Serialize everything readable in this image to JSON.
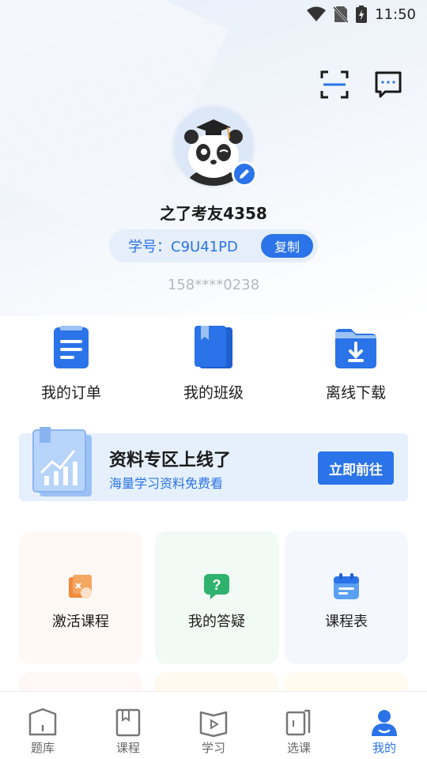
{
  "status_bar": {
    "time": "11:50"
  },
  "profile": {
    "username": "之了考友4358",
    "student_id_label": "学号：C9U41PD",
    "copy_label": "复制",
    "phone": "158****0238"
  },
  "quick_actions": [
    {
      "label": "我的订单",
      "icon": "order-icon"
    },
    {
      "label": "我的班级",
      "icon": "class-book-icon"
    },
    {
      "label": "离线下载",
      "icon": "download-folder-icon"
    }
  ],
  "banner": {
    "title": "资料专区上线了",
    "subtitle": "海量学习资料免费看",
    "button": "立即前往"
  },
  "cards": [
    {
      "label": "激活课程",
      "icon": "activate-icon"
    },
    {
      "label": "我的答疑",
      "icon": "question-icon"
    },
    {
      "label": "课程表",
      "icon": "calendar-icon"
    }
  ],
  "tabs": [
    {
      "label": "题库",
      "icon": "question-bank-icon"
    },
    {
      "label": "课程",
      "icon": "course-icon"
    },
    {
      "label": "学习",
      "icon": "study-icon"
    },
    {
      "label": "选课",
      "icon": "select-course-icon"
    },
    {
      "label": "我的",
      "icon": "profile-icon"
    }
  ],
  "colors": {
    "accent": "#2a73e8",
    "muted": "#b4b8bf"
  }
}
